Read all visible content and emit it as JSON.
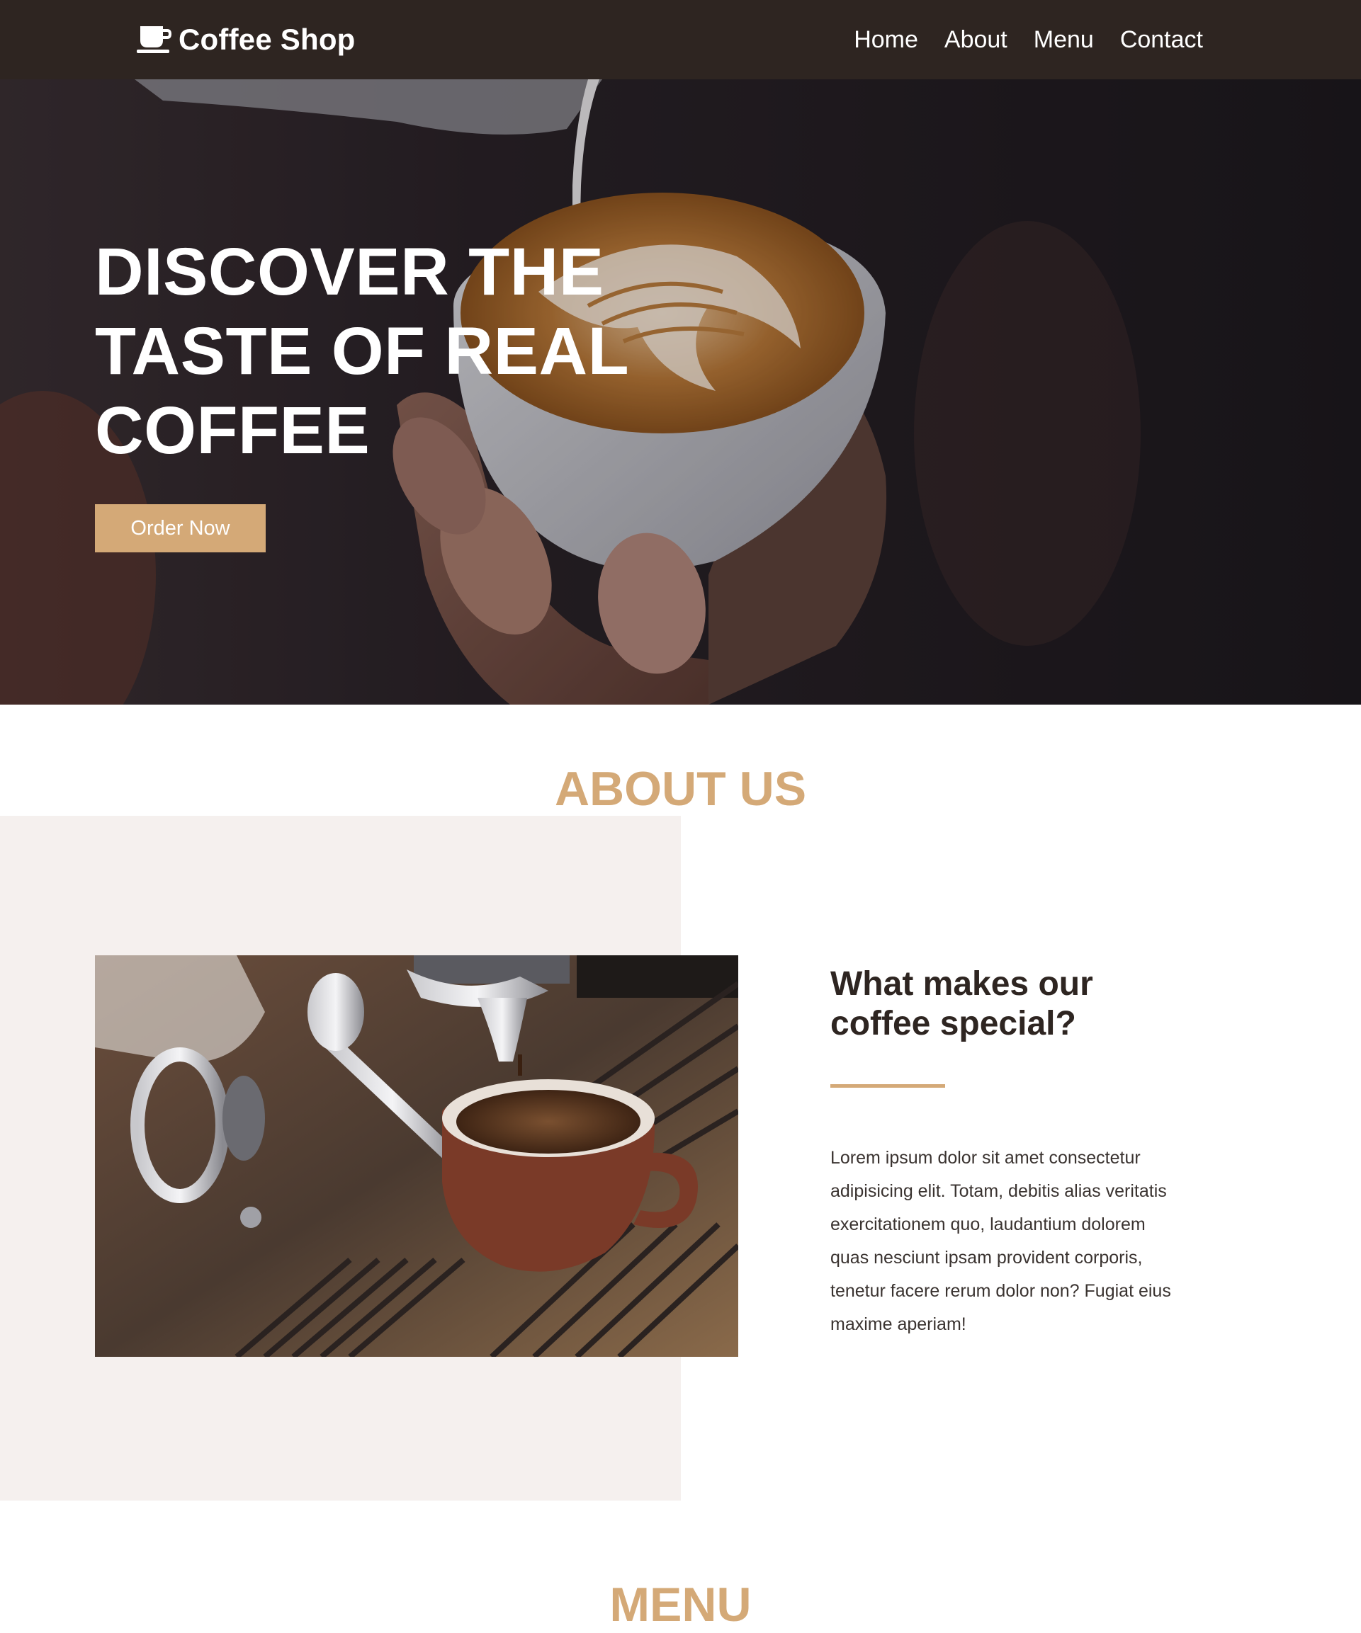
{
  "navbar": {
    "brand_text": "Coffee Shop",
    "brand_icon": "coffee-cup-icon",
    "links": [
      "Home",
      "About",
      "Menu",
      "Contact"
    ]
  },
  "hero": {
    "title_lines": [
      "DISCOVER THE",
      "TASTE OF REAL",
      "COFFEE"
    ],
    "cta_label": "Order Now"
  },
  "about": {
    "heading": "ABOUT US",
    "subheading": "What makes our coffee special?",
    "body": "Lorem ipsum dolor sit amet consectetur adipisicing elit. Totam, debitis alias veritatis exercitationem quo, laudantium dolorem quas nesciunt ipsam provident corporis, tenetur facere rerum dolor non? Fugiat eius maxime aperiam!"
  },
  "menu": {
    "heading": "MENU"
  },
  "colors": {
    "navbar_bg": "#2e2521",
    "accent": "#d4a977",
    "about_panel_bg": "#f5f0ee",
    "heading_dark": "#2e2521"
  }
}
